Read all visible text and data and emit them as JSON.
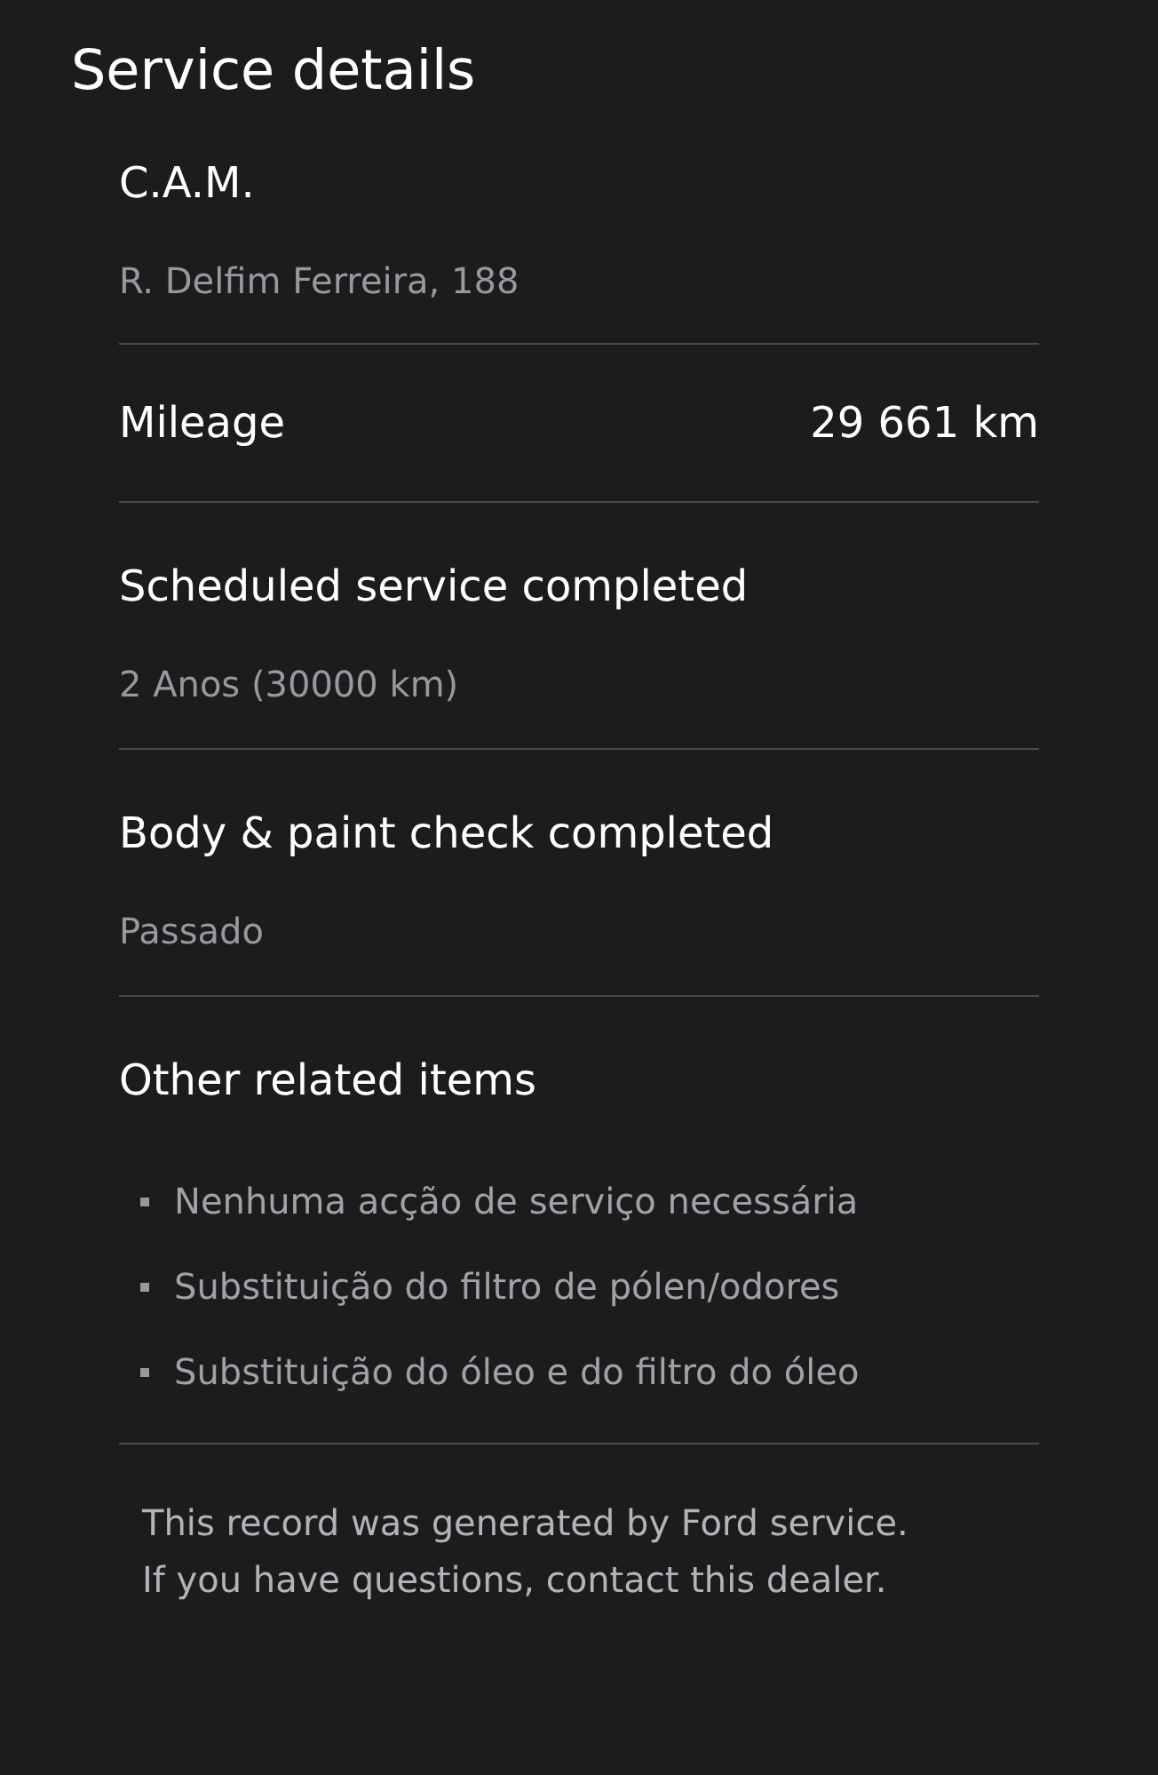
{
  "title": "Service details",
  "dealer": {
    "name": "C.A.M.",
    "address": "R. Delfim Ferreira, 188"
  },
  "mileage": {
    "label": "Mileage",
    "value": "29 661 km"
  },
  "sections": [
    {
      "title": "Scheduled service completed",
      "detail": "2 Anos (30000 km)"
    },
    {
      "title": "Body & paint check completed",
      "detail": "Passado"
    }
  ],
  "other": {
    "title": "Other related items",
    "items": [
      "Nenhuma acção de serviço necessária",
      "Substituição do filtro de pólen/odores",
      "Substituição do óleo e do filtro do óleo"
    ]
  },
  "footer": [
    "This record was generated by Ford service.",
    "If you have questions, contact this dealer."
  ]
}
